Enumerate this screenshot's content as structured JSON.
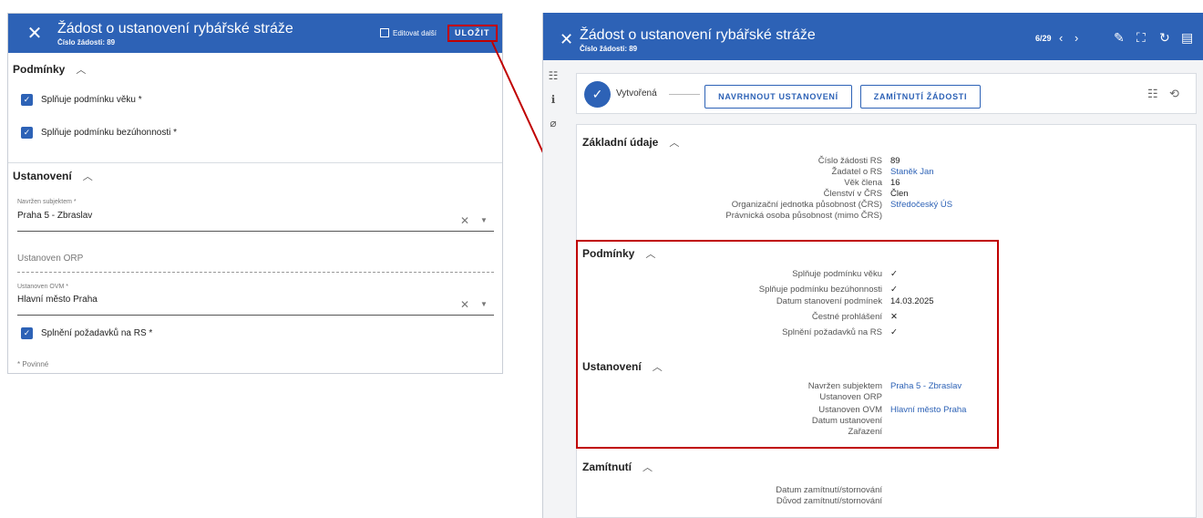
{
  "left_panel": {
    "title": "Žádost o ustanovení rybářské stráže",
    "subtitle": "Číslo žádosti: 89",
    "edit_next_label": "Editovat další",
    "save_label": "ULOŽIT",
    "close_icon": "close-icon",
    "conditions": {
      "heading": "Podmínky",
      "items": [
        {
          "label": "Splňuje podmínku věku *",
          "checked": true
        },
        {
          "label": "Splňuje podmínku bezúhonnosti *",
          "checked": true
        }
      ]
    },
    "appointment": {
      "heading": "Ustanovení",
      "proposed_by": {
        "label": "Navržen subjektem *",
        "value": "Praha 5 - Zbraslav"
      },
      "orp": {
        "placeholder": "Ustanoven ORP"
      },
      "ovm": {
        "label": "Ustanoven OVM *",
        "value": "Hlavní město Praha"
      },
      "requirements": {
        "label": "Splnění požadavků na RS *",
        "checked": true
      }
    },
    "required_note": "* Povinné"
  },
  "right_panel": {
    "title": "Žádost o ustanovení rybářské stráže",
    "subtitle": "Číslo žádosti: 89",
    "pager": "6/29",
    "status": {
      "label": "Vytvořená",
      "btn_propose": "NAVRHNOUT USTANOVENÍ",
      "btn_reject": "ZAMÍTNUTÍ ŽÁDOSTI"
    },
    "basic": {
      "heading": "Základní údaje",
      "rows": [
        {
          "label": "Číslo žádosti RS",
          "value": "89"
        },
        {
          "label": "Žadatel o RS",
          "value": "Staněk Jan"
        },
        {
          "label": "Věk člena",
          "value": "16"
        },
        {
          "label": "Členství v ČRS",
          "value": "Člen"
        },
        {
          "label": "Organizační jednotka působnost (ČRS)",
          "value": "Středočeský ÚS"
        },
        {
          "label": "Právnická osoba působnost (mimo ČRS)",
          "value": ""
        }
      ]
    },
    "conditions": {
      "heading": "Podmínky",
      "rows": [
        {
          "label": "Splňuje podmínku věku",
          "value": "✓"
        },
        {
          "label": "Splňuje podmínku bezúhonnosti",
          "value": "✓"
        },
        {
          "label": "Datum stanovení podmínek",
          "value": "14.03.2025"
        },
        {
          "label": "Čestné prohlášení",
          "value": "✕"
        },
        {
          "label": "Splnění požadavků na RS",
          "value": "✓"
        }
      ]
    },
    "appointment": {
      "heading": "Ustanovení",
      "rows": [
        {
          "label": "Navržen subjektem",
          "value": "Praha 5 - Zbraslav"
        },
        {
          "label": "Ustanoven ORP",
          "value": ""
        },
        {
          "label": "Ustanoven OVM",
          "value": "Hlavní město Praha"
        },
        {
          "label": "Datum ustanovení",
          "value": ""
        },
        {
          "label": "Zařazení",
          "value": ""
        }
      ]
    },
    "rejection": {
      "heading": "Zamítnutí",
      "rows": [
        {
          "label": "Datum zamítnutí/stornování",
          "value": ""
        },
        {
          "label": "Důvod zamítnutí/stornování",
          "value": ""
        }
      ]
    }
  },
  "colors": {
    "primary": "#2d62b6",
    "highlight": "#c00000"
  }
}
